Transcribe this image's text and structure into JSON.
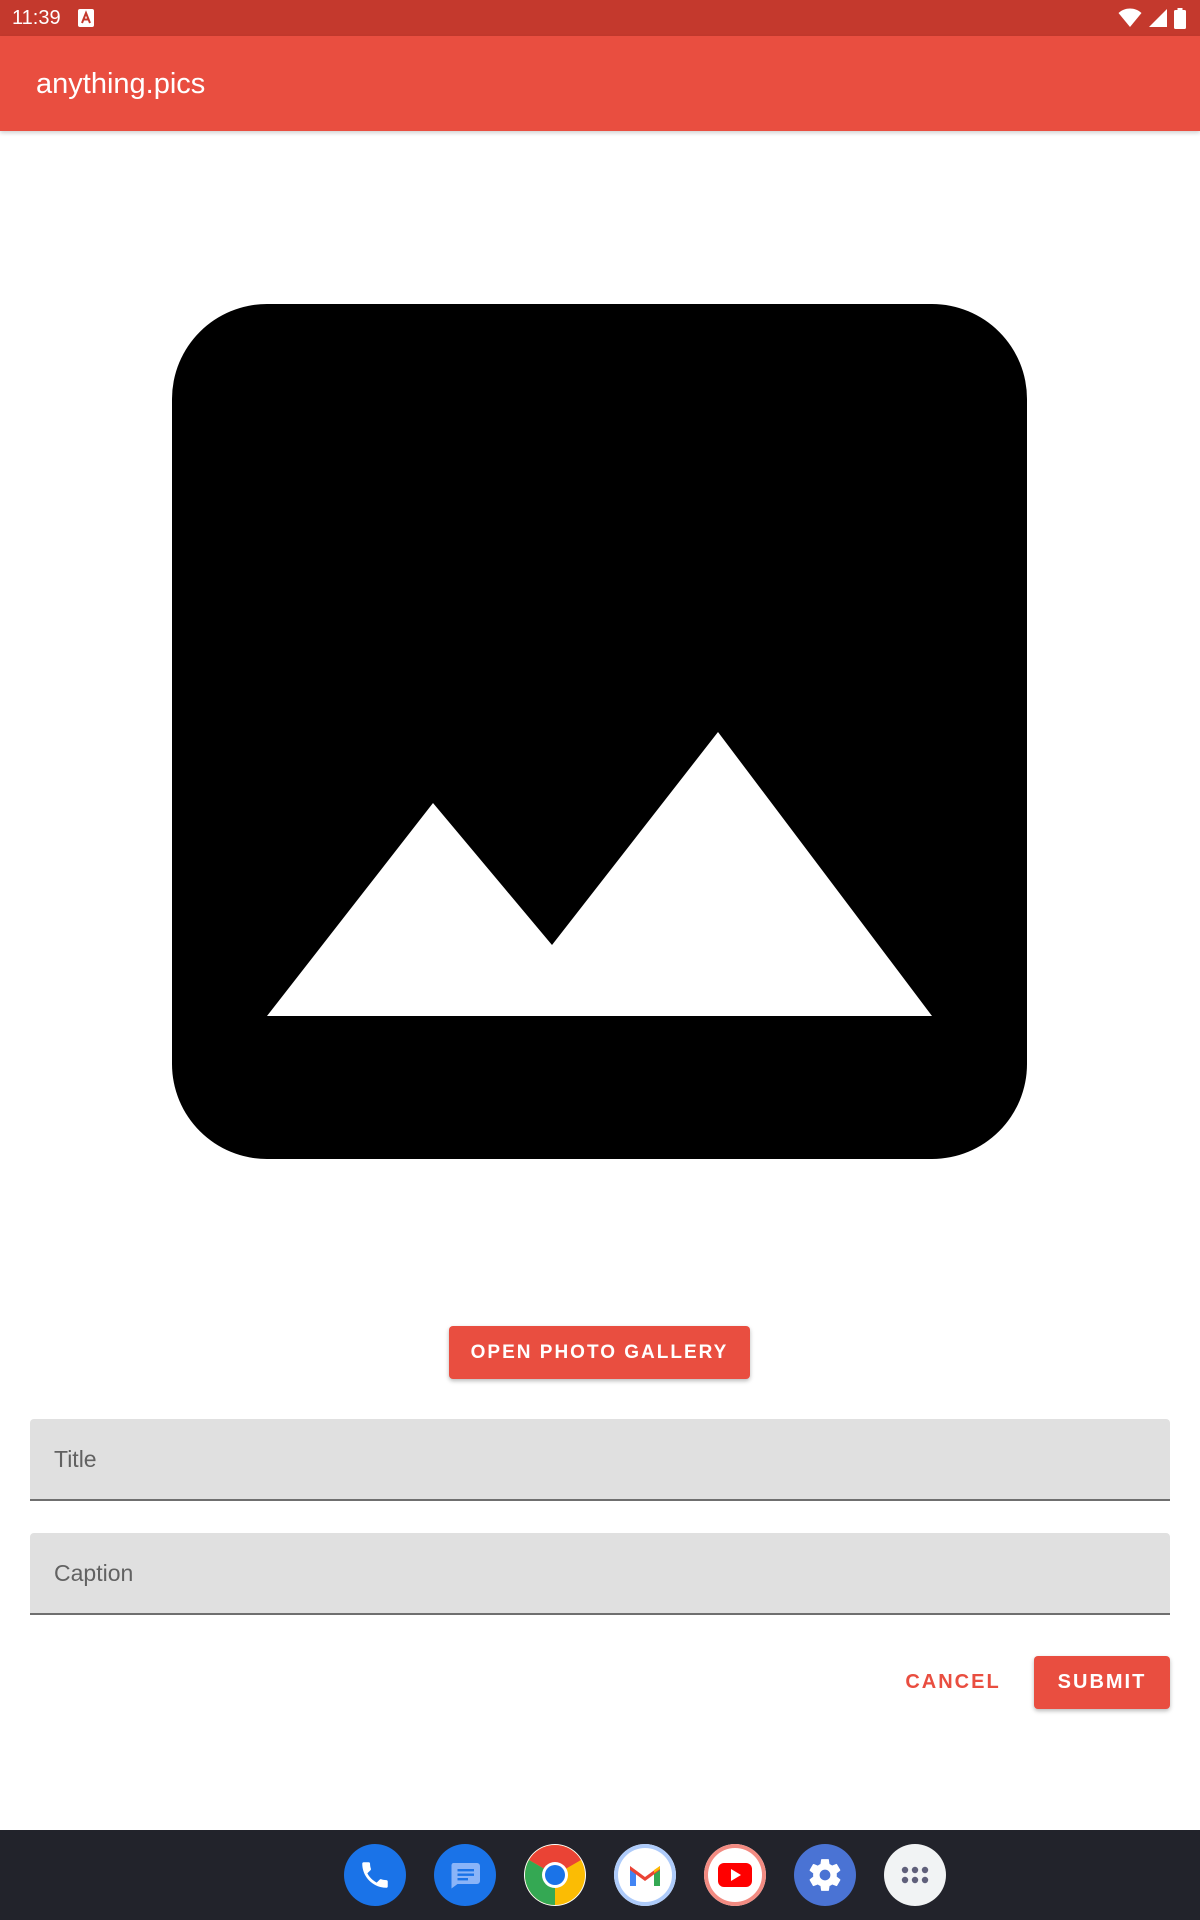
{
  "status_bar": {
    "time": "11:39",
    "notification_icon": "text-a-icon",
    "wifi_icon": "wifi-icon",
    "signal_icon": "cell-signal-icon",
    "battery_icon": "battery-icon"
  },
  "app_bar": {
    "title": "anything.pics"
  },
  "image_preview": {
    "icon": "image-placeholder-icon"
  },
  "gallery_button": {
    "label": "OPEN PHOTO GALLERY"
  },
  "form": {
    "title_placeholder": "Title",
    "title_value": "",
    "caption_placeholder": "Caption",
    "caption_value": "",
    "cancel_label": "CANCEL",
    "submit_label": "SUBMIT"
  },
  "dock": {
    "apps": [
      {
        "name": "phone",
        "icon": "phone-icon"
      },
      {
        "name": "messages",
        "icon": "messages-icon"
      },
      {
        "name": "chrome",
        "icon": "chrome-icon"
      },
      {
        "name": "gmail",
        "icon": "gmail-icon"
      },
      {
        "name": "youtube",
        "icon": "youtube-icon"
      },
      {
        "name": "settings",
        "icon": "settings-gear-icon"
      },
      {
        "name": "app drawer",
        "icon": "app-drawer-icon"
      }
    ]
  },
  "colors": {
    "status_bar": "#c4392d",
    "primary": "#e94e40",
    "field_background": "#e0e0e0",
    "dock_background": "#22232b"
  }
}
